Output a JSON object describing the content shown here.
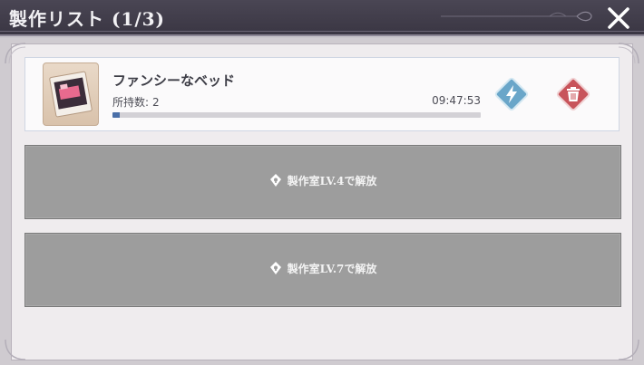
{
  "header": {
    "title": "製作リスト (1/3)",
    "close_icon": "close-icon"
  },
  "craft_item": {
    "name": "ファンシーなベッド",
    "owned_label": "所持数:",
    "owned_count": "2",
    "timer": "09:47:53",
    "progress": 0.02,
    "speedup_icon": "lightning-icon",
    "delete_icon": "trash-icon"
  },
  "locked_slots": [
    {
      "label": "製作室LV.4で解放",
      "icon": "lock-icon"
    },
    {
      "label": "製作室LV.7で解放",
      "icon": "lock-icon"
    }
  ],
  "colors": {
    "title_bar": "#3f3b48",
    "speedup_button": "#6aa6c9",
    "delete_button": "#c8545b",
    "locked_slot": "#9d9d9d",
    "progress_fill": "#4a6fa8"
  }
}
